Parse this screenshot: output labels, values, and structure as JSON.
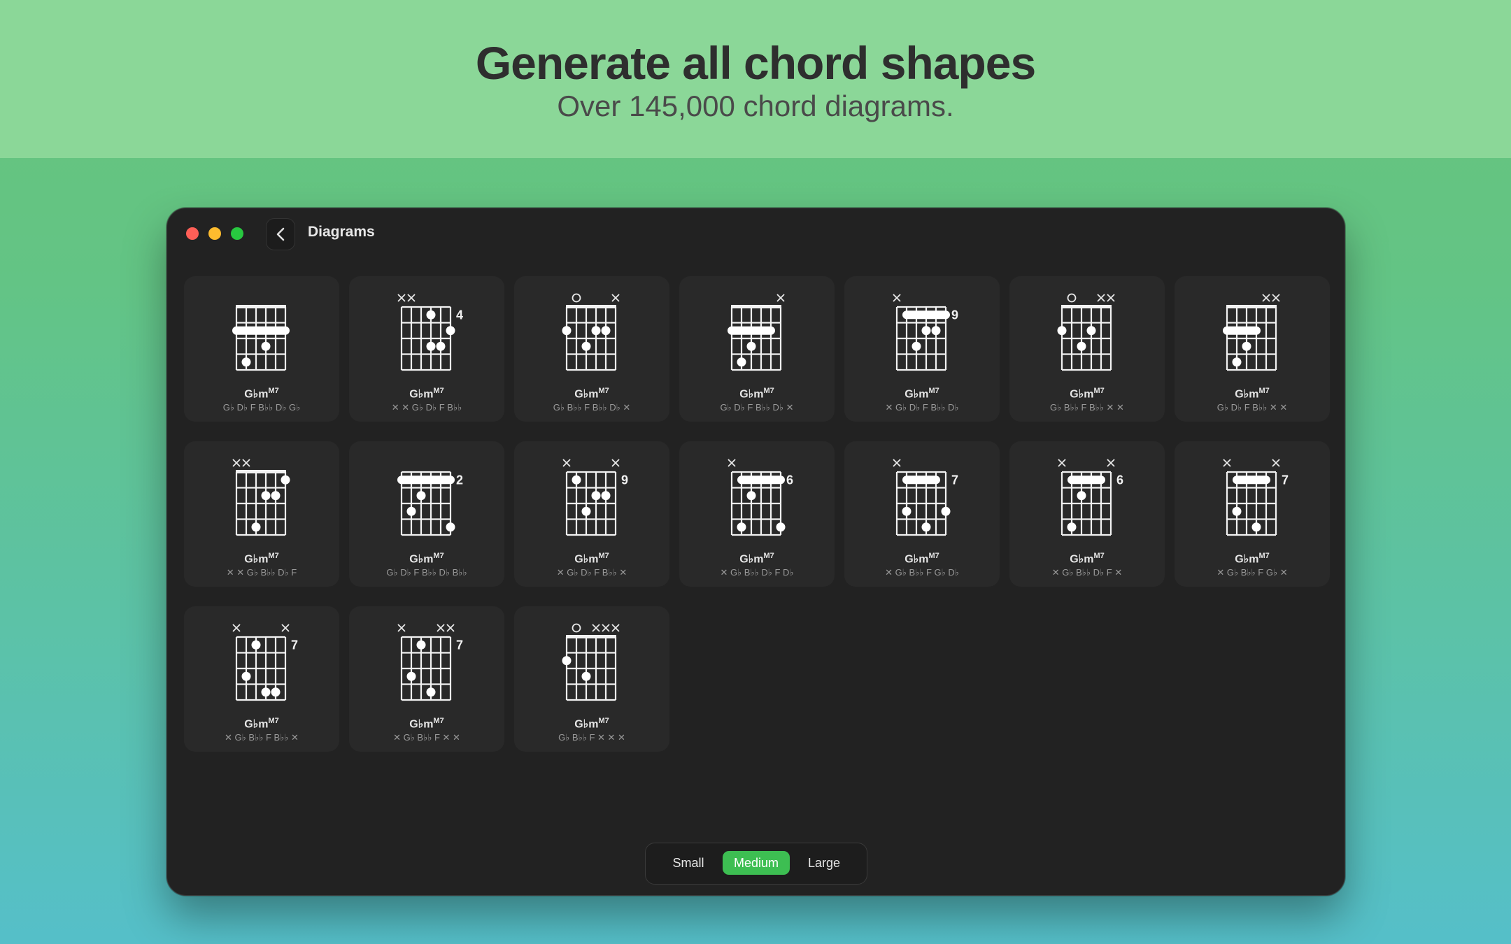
{
  "hero": {
    "title": "Generate all chord shapes",
    "subtitle": "Over 145,000 chord diagrams."
  },
  "window": {
    "title": "Diagrams",
    "traffic_colors": [
      "#ff5f57",
      "#febc2e",
      "#28c840"
    ]
  },
  "chords": [
    {
      "name": "G♭m",
      "sup": "M7",
      "notes": "G♭ D♭ F B♭♭ D♭ G♭",
      "markers": [
        "",
        "",
        "",
        "",
        "",
        ""
      ],
      "fret": "",
      "barre": [
        0,
        5,
        2
      ],
      "dots": [
        [
          3,
          3
        ],
        [
          1,
          4
        ]
      ]
    },
    {
      "name": "G♭m",
      "sup": "M7",
      "notes": "✕ ✕ G♭ D♭ F B♭♭",
      "markers": [
        "x",
        "x",
        "",
        "",
        "",
        ""
      ],
      "fret": "4",
      "barre": null,
      "dots": [
        [
          3,
          1
        ],
        [
          5,
          2
        ],
        [
          3,
          3
        ],
        [
          4,
          3
        ]
      ]
    },
    {
      "name": "G♭m",
      "sup": "M7",
      "notes": "G♭ B♭♭ F B♭♭ D♭ ✕",
      "markers": [
        "",
        "o",
        "",
        "",
        "",
        "x"
      ],
      "fret": "",
      "barre": null,
      "dots": [
        [
          0,
          2
        ],
        [
          3,
          2
        ],
        [
          4,
          2
        ],
        [
          2,
          3
        ]
      ]
    },
    {
      "name": "G♭m",
      "sup": "M7",
      "notes": "G♭ D♭ F B♭♭ D♭ ✕",
      "markers": [
        "",
        "",
        "",
        "",
        "",
        "x"
      ],
      "fret": "",
      "barre": [
        0,
        4,
        2
      ],
      "dots": [
        [
          2,
          3
        ],
        [
          1,
          4
        ]
      ]
    },
    {
      "name": "G♭m",
      "sup": "M7",
      "notes": "✕ G♭ D♭ F B♭♭ D♭",
      "markers": [
        "x",
        "",
        "",
        "",
        "",
        ""
      ],
      "fret": "9",
      "barre": [
        1,
        5,
        1
      ],
      "dots": [
        [
          3,
          2
        ],
        [
          4,
          2
        ],
        [
          2,
          3
        ]
      ]
    },
    {
      "name": "G♭m",
      "sup": "M7",
      "notes": "G♭ B♭♭ F B♭♭ ✕ ✕",
      "markers": [
        "",
        "o",
        "",
        "",
        "x",
        "x"
      ],
      "fret": "",
      "barre": null,
      "dots": [
        [
          0,
          2
        ],
        [
          3,
          2
        ],
        [
          2,
          3
        ]
      ]
    },
    {
      "name": "G♭m",
      "sup": "M7",
      "notes": "G♭ D♭ F B♭♭ ✕ ✕",
      "markers": [
        "",
        "",
        "",
        "",
        "x",
        "x"
      ],
      "fret": "",
      "barre": [
        0,
        3,
        2
      ],
      "dots": [
        [
          2,
          3
        ],
        [
          1,
          4
        ]
      ]
    },
    {
      "name": "G♭m",
      "sup": "M7",
      "notes": "✕ ✕ G♭ B♭♭ D♭ F",
      "markers": [
        "x",
        "x",
        "",
        "",
        "",
        ""
      ],
      "fret": "",
      "barre": null,
      "dots": [
        [
          5,
          1
        ],
        [
          3,
          2
        ],
        [
          4,
          2
        ],
        [
          2,
          4
        ]
      ]
    },
    {
      "name": "G♭m",
      "sup": "M7",
      "notes": "G♭ D♭ F B♭♭ D♭ B♭♭",
      "markers": [
        "",
        "",
        "",
        "",
        "",
        ""
      ],
      "fret": "2",
      "barre": [
        0,
        5,
        1
      ],
      "dots": [
        [
          2,
          2
        ],
        [
          1,
          3
        ],
        [
          5,
          4
        ]
      ]
    },
    {
      "name": "G♭m",
      "sup": "M7",
      "notes": "✕ G♭ D♭ F B♭♭ ✕",
      "markers": [
        "x",
        "",
        "",
        "",
        "",
        "x"
      ],
      "fret": "9",
      "barre": null,
      "dots": [
        [
          1,
          1
        ],
        [
          3,
          2
        ],
        [
          4,
          2
        ],
        [
          2,
          3
        ]
      ]
    },
    {
      "name": "G♭m",
      "sup": "M7",
      "notes": "✕ G♭ B♭♭ D♭ F D♭",
      "markers": [
        "x",
        "",
        "",
        "",
        "",
        ""
      ],
      "fret": "6",
      "barre": [
        1,
        5,
        1
      ],
      "dots": [
        [
          2,
          2
        ],
        [
          1,
          4
        ],
        [
          5,
          4
        ]
      ]
    },
    {
      "name": "G♭m",
      "sup": "M7",
      "notes": "✕ G♭ B♭♭ F G♭ D♭",
      "markers": [
        "x",
        "",
        "",
        "",
        "",
        ""
      ],
      "fret": "7",
      "barre": [
        1,
        4,
        1
      ],
      "dots": [
        [
          1,
          3
        ],
        [
          5,
          3
        ],
        [
          3,
          4
        ]
      ]
    },
    {
      "name": "G♭m",
      "sup": "M7",
      "notes": "✕ G♭ B♭♭ D♭ F ✕",
      "markers": [
        "x",
        "",
        "",
        "",
        "",
        "x"
      ],
      "fret": "6",
      "barre": [
        1,
        4,
        1
      ],
      "dots": [
        [
          2,
          2
        ],
        [
          1,
          4
        ]
      ]
    },
    {
      "name": "G♭m",
      "sup": "M7",
      "notes": "✕ G♭ B♭♭ F G♭ ✕",
      "markers": [
        "x",
        "",
        "",
        "",
        "",
        "x"
      ],
      "fret": "7",
      "barre": [
        1,
        4,
        1
      ],
      "dots": [
        [
          1,
          3
        ],
        [
          3,
          4
        ]
      ]
    },
    {
      "name": "G♭m",
      "sup": "M7",
      "notes": "✕ G♭ B♭♭ F B♭♭ ✕",
      "markers": [
        "x",
        "",
        "",
        "",
        "",
        "x"
      ],
      "fret": "7",
      "barre": null,
      "dots": [
        [
          2,
          1
        ],
        [
          1,
          3
        ],
        [
          3,
          4
        ],
        [
          4,
          4
        ]
      ]
    },
    {
      "name": "G♭m",
      "sup": "M7",
      "notes": "✕ G♭ B♭♭ F ✕ ✕",
      "markers": [
        "x",
        "",
        "",
        "",
        "x",
        "x"
      ],
      "fret": "7",
      "barre": null,
      "dots": [
        [
          2,
          1
        ],
        [
          1,
          3
        ],
        [
          3,
          4
        ]
      ]
    },
    {
      "name": "G♭m",
      "sup": "M7",
      "notes": "G♭ B♭♭ F ✕ ✕ ✕",
      "markers": [
        "",
        "o",
        "",
        "x",
        "x",
        "x"
      ],
      "fret": "",
      "barre": null,
      "dots": [
        [
          0,
          2
        ],
        [
          2,
          3
        ]
      ]
    }
  ],
  "size_control": {
    "options": [
      "Small",
      "Medium",
      "Large"
    ],
    "selected": "Medium"
  }
}
